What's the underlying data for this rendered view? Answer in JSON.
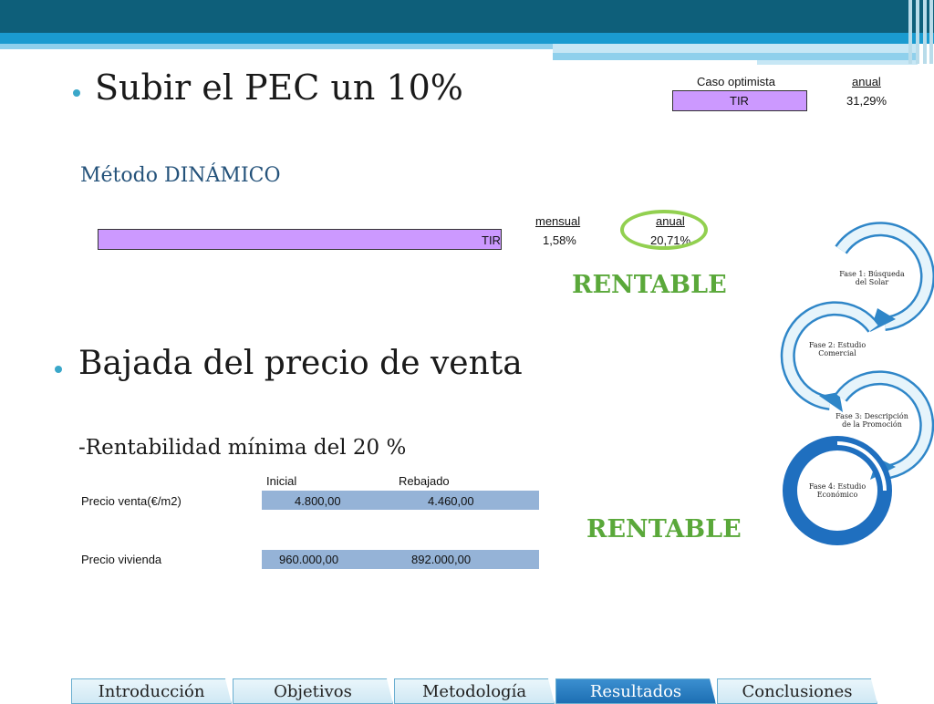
{
  "slide": {
    "bullet1": "Subir el PEC un 10%",
    "optimista_header": "Caso optimista",
    "optimista_anual": "anual",
    "optimista_tir_label": "TIR",
    "optimista_tir_value": "31,29%",
    "metodo": "Método DINÁMICO",
    "din_mensual_header": "mensual",
    "din_anual_header": "anual",
    "din_tir_label": "TIR",
    "din_mensual_value": "1,58%",
    "din_anual_value": "20,71%",
    "rentable1": "RENTABLE",
    "bullet2": "Bajada del precio de venta",
    "minima": "-Rentabilidad mínima del 20 %",
    "table": {
      "col_inicial": "Inicial",
      "col_rebajado": "Rebajado",
      "rows": [
        {
          "label": "Precio venta(€/m2)",
          "inicial": "4.800,00",
          "rebajado": "4.460,00"
        },
        {
          "label": "Precio vivienda",
          "inicial": "960.000,00",
          "rebajado": "892.000,00"
        }
      ]
    },
    "rentable2": "RENTABLE"
  },
  "diagram": {
    "phase1": [
      "Fase 1: Búsqueda",
      "del  Solar"
    ],
    "phase2": [
      "Fase 2: Estudio",
      "Comercial"
    ],
    "phase3": [
      "Fase 3: Descripción",
      "de la      Promoción"
    ],
    "phase4": [
      "Fase 4: Estudio",
      "Económico"
    ]
  },
  "nav": {
    "tabs": [
      {
        "label": "Introducción",
        "active": false
      },
      {
        "label": "Objetivos",
        "active": false
      },
      {
        "label": "Metodología",
        "active": false
      },
      {
        "label": "Resultados",
        "active": true
      },
      {
        "label": "Conclusiones",
        "active": false
      }
    ]
  },
  "colors": {
    "accent_green": "#5aa83a",
    "tir_fill": "#cc99ff",
    "value_fill": "#95b3d7",
    "header_dark": "#0e5f7a"
  }
}
